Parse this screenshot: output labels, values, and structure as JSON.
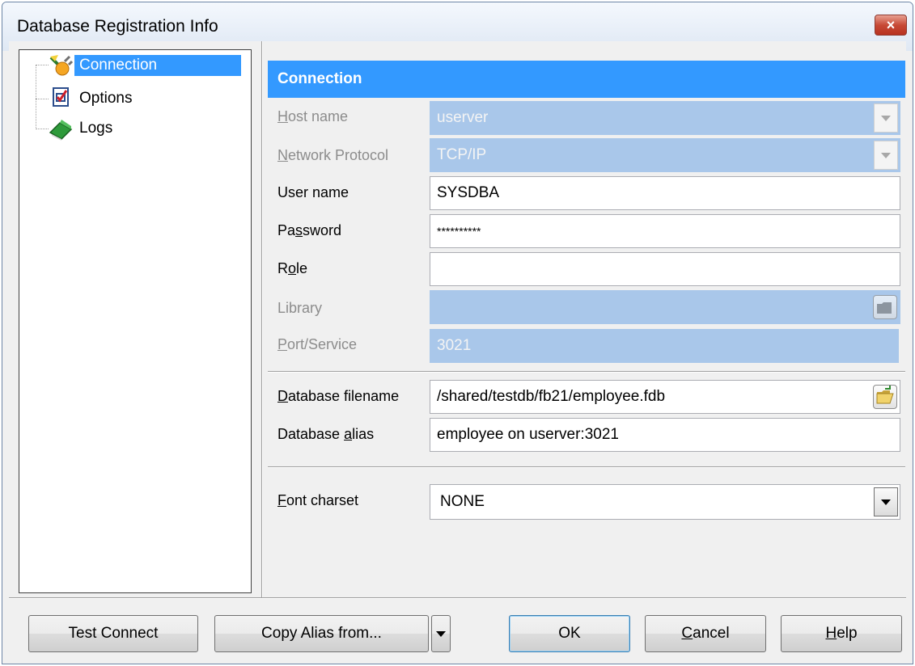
{
  "window": {
    "title": "Database Registration Info",
    "close_label": "×"
  },
  "tree": {
    "items": [
      {
        "label": "Connection",
        "icon": "plug-icon",
        "selected": true
      },
      {
        "label": "Options",
        "icon": "checklist-icon",
        "selected": false
      },
      {
        "label": "Logs",
        "icon": "book-icon",
        "selected": false
      }
    ]
  },
  "panel": {
    "header": "Connection",
    "host_name": {
      "label_pre": "",
      "label_key": "H",
      "label_post": "ost name",
      "value": "userver",
      "enabled": false
    },
    "network_protocol": {
      "label_pre": "",
      "label_key": "N",
      "label_post": "etwork Protocol",
      "value": "TCP/IP",
      "enabled": false
    },
    "user_name": {
      "label": "User name",
      "value": "SYSDBA"
    },
    "password": {
      "label_pre": "Pa",
      "label_key": "s",
      "label_post": "sword",
      "value": "**********"
    },
    "role": {
      "label_pre": "R",
      "label_key": "o",
      "label_post": "le",
      "value": ""
    },
    "library": {
      "label": "Library",
      "value": "",
      "enabled": false
    },
    "port_service": {
      "label_pre": "",
      "label_key": "P",
      "label_post": "ort/Service",
      "value": "3021",
      "enabled": false
    },
    "database_filename": {
      "label_pre": "",
      "label_key": "D",
      "label_post": "atabase filename",
      "value": "/shared/testdb/fb21/employee.fdb"
    },
    "database_alias": {
      "label_pre": "Database ",
      "label_key": "a",
      "label_post": "lias",
      "value": "employee on userver:3021"
    },
    "font_charset": {
      "label_pre": "",
      "label_key": "F",
      "label_post": "ont charset",
      "value": "NONE"
    }
  },
  "buttons": {
    "test_connect": "Test Connect",
    "copy_alias": "Copy Alias from...",
    "ok": "OK",
    "cancel_pre": "",
    "cancel_key": "C",
    "cancel_post": "ancel",
    "help_pre": "",
    "help_key": "H",
    "help_post": "elp"
  }
}
